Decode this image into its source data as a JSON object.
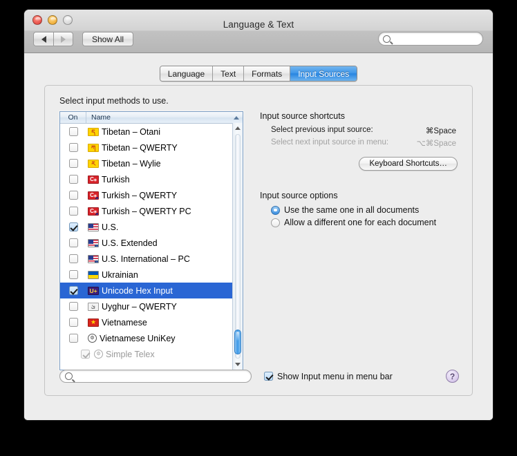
{
  "window": {
    "title": "Language & Text",
    "traffic_lights": [
      "close",
      "minimize",
      "zoom"
    ],
    "nav_back": "◀",
    "nav_forward": "▶",
    "show_all_label": "Show All",
    "toolbar_search_placeholder": "",
    "toolbar_search_value": ""
  },
  "tabs": [
    {
      "label": "Language",
      "active": false
    },
    {
      "label": "Text",
      "active": false
    },
    {
      "label": "Formats",
      "active": false
    },
    {
      "label": "Input Sources",
      "active": true
    }
  ],
  "caption": "Select input methods to use.",
  "list": {
    "columns": {
      "on": "On",
      "name": "Name"
    },
    "sort": "ascending",
    "rows": [
      {
        "name": "Tibetan – Otani",
        "checked": false,
        "selected": false,
        "icon": "tibetan-flag-icon",
        "glyph": "ད",
        "kind": "tibet",
        "badge": ""
      },
      {
        "name": "Tibetan – QWERTY",
        "checked": false,
        "selected": false,
        "icon": "tibetan-flag-icon",
        "glyph": "ཀ",
        "kind": "tibet",
        "badge": ""
      },
      {
        "name": "Tibetan – Wylie",
        "checked": false,
        "selected": false,
        "icon": "tibetan-flag-icon",
        "glyph": "ར",
        "kind": "tibet",
        "badge": ""
      },
      {
        "name": "Turkish",
        "checked": false,
        "selected": false,
        "icon": "turkish-flag-icon",
        "glyph": "C⁎",
        "kind": "turkish",
        "badge": ""
      },
      {
        "name": "Turkish – QWERTY",
        "checked": false,
        "selected": false,
        "icon": "turkish-flag-icon",
        "glyph": "C⁎",
        "kind": "turkish",
        "badge": "dot"
      },
      {
        "name": "Turkish – QWERTY PC",
        "checked": false,
        "selected": false,
        "icon": "turkish-flag-icon",
        "glyph": "C⁎",
        "kind": "turkish",
        "badge": "dot"
      },
      {
        "name": "U.S.",
        "checked": true,
        "selected": false,
        "icon": "us-flag-icon",
        "glyph": "",
        "kind": "us",
        "badge": ""
      },
      {
        "name": "U.S. Extended",
        "checked": false,
        "selected": false,
        "icon": "us-flag-icon",
        "glyph": "",
        "kind": "us",
        "badge": "sq"
      },
      {
        "name": "U.S. International – PC",
        "checked": false,
        "selected": false,
        "icon": "us-flag-icon",
        "glyph": "",
        "kind": "us",
        "badge": "sq"
      },
      {
        "name": "Ukrainian",
        "checked": false,
        "selected": false,
        "icon": "ukraine-flag-icon",
        "glyph": "",
        "kind": "ukr",
        "badge": ""
      },
      {
        "name": "Unicode Hex Input",
        "checked": true,
        "selected": true,
        "icon": "unicode-hex-icon",
        "glyph": "U+",
        "kind": "uplus",
        "badge": ""
      },
      {
        "name": "Uyghur – QWERTY",
        "checked": false,
        "selected": false,
        "icon": "uyghur-icon",
        "glyph": "ئ",
        "kind": "uyghur",
        "badge": ""
      },
      {
        "name": "Vietnamese",
        "checked": false,
        "selected": false,
        "icon": "vietnam-flag-icon",
        "glyph": "★",
        "kind": "viet",
        "badge": ""
      },
      {
        "name": "Vietnamese UniKey",
        "checked": false,
        "selected": false,
        "icon": "vietnamese-unikey-icon",
        "glyph": "⚙",
        "kind": "unikey",
        "badge": ""
      },
      {
        "name": "Simple Telex",
        "checked": true,
        "selected": false,
        "icon": "simple-telex-icon",
        "glyph": "⚙",
        "kind": "telex",
        "badge": "",
        "sub": true,
        "dim": true
      }
    ]
  },
  "shortcuts": {
    "title": "Input source shortcuts",
    "rows": [
      {
        "label": "Select previous input source:",
        "key": "⌘Space",
        "disabled": false
      },
      {
        "label": "Select next input source in menu:",
        "key": "⌥⌘Space",
        "disabled": true
      }
    ],
    "button_label": "Keyboard Shortcuts…"
  },
  "options": {
    "title": "Input source options",
    "radios": [
      {
        "label": "Use the same one in all documents",
        "selected": true
      },
      {
        "label": "Allow a different one for each document",
        "selected": false
      }
    ]
  },
  "bottom": {
    "search_placeholder": "",
    "search_value": "",
    "show_menu_label": "Show Input menu in menu bar",
    "show_menu_checked": true,
    "help_label": "?"
  },
  "colors": {
    "selection_blue": "#2a66d4",
    "tab_active_blue": "#3e95e8",
    "window_bg": "#ededed",
    "desktop": "#000000"
  }
}
